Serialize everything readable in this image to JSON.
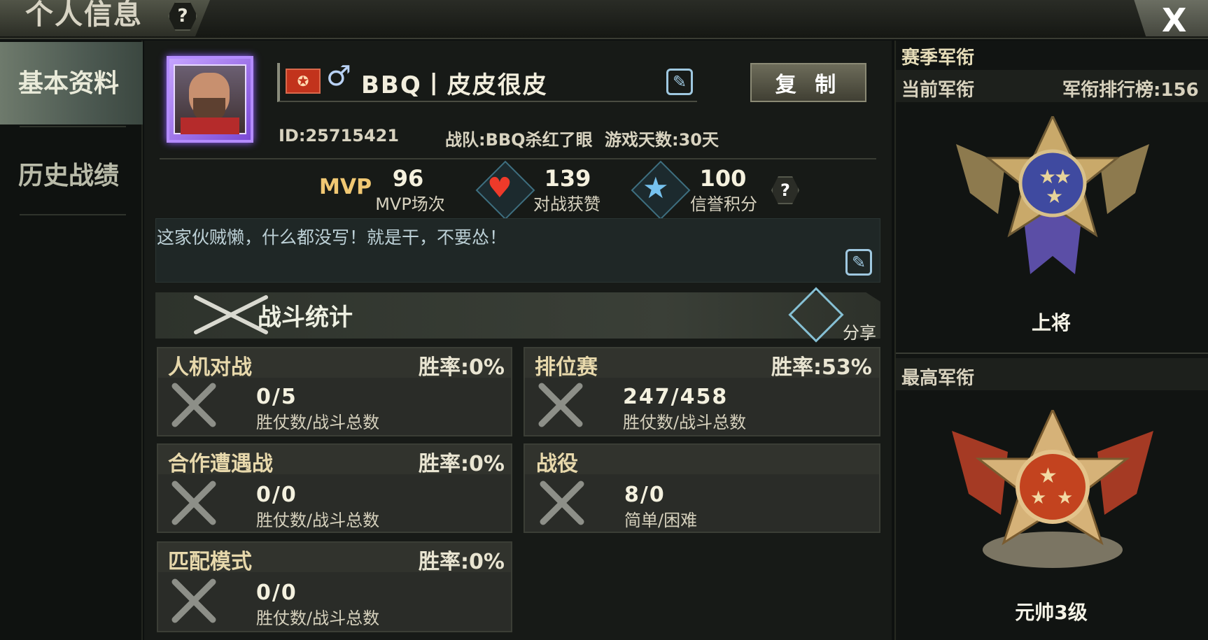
{
  "window": {
    "title": "个人信息",
    "help": "?",
    "close": "X"
  },
  "sidebar": {
    "items": [
      {
        "label": "基本资料"
      },
      {
        "label": "历史战绩"
      }
    ]
  },
  "profile": {
    "name": "BBQ丨皮皮很皮",
    "gender_symbol": "♂",
    "copy_label": "复 制",
    "id_text": "ID:25715421",
    "team_text": "战队:BBQ杀红了眼",
    "days_text": "游戏天数:30天"
  },
  "stats": [
    {
      "icon": "MVP",
      "value": "96",
      "label": "MVP场次"
    },
    {
      "icon": "heart",
      "value": "139",
      "label": "对战获赞"
    },
    {
      "icon": "star",
      "value": "100",
      "label": "信誉积分"
    }
  ],
  "signature": "这家伙贼懒，什么都没写！就是干，不要怂！",
  "combat": {
    "title": "战斗统计",
    "share": "分享"
  },
  "cards": [
    {
      "title": "人机对战",
      "rate": "胜率:0%",
      "value": "0/5",
      "sub": "胜仗数/战斗总数"
    },
    {
      "title": "排位赛",
      "rate": "胜率:53%",
      "value": "247/458",
      "sub": "胜仗数/战斗总数"
    },
    {
      "title": "合作遭遇战",
      "rate": "胜率:0%",
      "value": "0/0",
      "sub": "胜仗数/战斗总数"
    },
    {
      "title": "战役",
      "rate": "",
      "value": "8/0",
      "sub": "简单/困难"
    },
    {
      "title": "匹配模式",
      "rate": "胜率:0%",
      "value": "0/0",
      "sub": "胜仗数/战斗总数"
    }
  ],
  "right": {
    "season_header": "赛季军衔",
    "current_label": "当前军衔",
    "leaderboard": "军衔排行榜:156",
    "current_rank": "上将",
    "highest_label": "最高军衔",
    "highest_rank": "元帅3级"
  },
  "colors": {
    "accent_gold": "#e7d8ab",
    "icon_cyan": "#86c0d4",
    "rank_red": "#c2331c",
    "frame_purple": "#b48cff"
  }
}
